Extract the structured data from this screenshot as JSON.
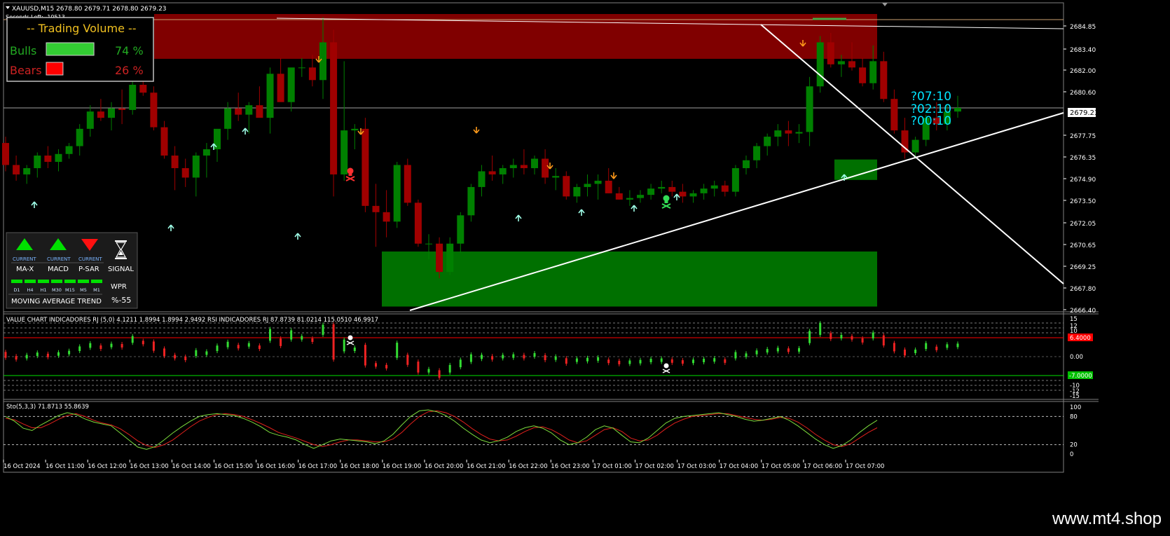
{
  "header": {
    "symbol_line": "XAUUSD,M15  2678.80 2679.71 2678.80 2679.23",
    "seconds_left": "Seconds Left:  -10513"
  },
  "volume_panel": {
    "title": "-- Trading Volume --",
    "bulls_label": "Bulls",
    "bulls_pct_text": "74 %",
    "bulls_fraction": 0.74,
    "bears_label": "Bears",
    "bears_pct_text": "26 %",
    "bears_fraction": 0.26
  },
  "timers": [
    "?07:10",
    "?02:10",
    "?00:10"
  ],
  "price_axis": {
    "ticks": [
      "2684.85",
      "2683.40",
      "2682.00",
      "2680.60",
      "2679.23",
      "2677.75",
      "2676.35",
      "2674.90",
      "2673.50",
      "2672.05",
      "2670.65",
      "2669.25",
      "2667.80",
      "2666.40"
    ],
    "current_price": "2679.23"
  },
  "signal_panel": {
    "indicators": [
      {
        "label": "MA-X",
        "status": "CURRENT",
        "direction": "up"
      },
      {
        "label": "MACD",
        "status": "CURRENT",
        "direction": "up"
      },
      {
        "label": "P-SAR",
        "status": "CURRENT",
        "direction": "down"
      }
    ],
    "signal_label": "SIGNAL",
    "timeframes": [
      "D1",
      "H4",
      "H1",
      "M30",
      "M15",
      "M5",
      "M1"
    ],
    "trend_label": "MOVING AVERAGE TREND",
    "wpr_label": "WPR",
    "wpr_value": "%-55"
  },
  "value_chart_panel": {
    "title": "VALUE CHART INDICADORES RJ (5,0) 4.1211 1.8994 1.8994 2.9492  RSI INDICADORES RJ 87.8739 81.0214 115.0510 46.9917",
    "axis_ticks": [
      "15",
      "12",
      "10",
      "0.00",
      "-10",
      "-12",
      "-15"
    ],
    "upper_level": "6.4000",
    "lower_level": "-7.0000"
  },
  "stoch_panel": {
    "title": "Sto(5,3,3) 71.8713 55.8639",
    "axis_ticks": [
      "100",
      "80",
      "20",
      "0"
    ],
    "main_line": [
      80,
      70,
      55,
      50,
      62,
      72,
      82,
      88,
      84,
      75,
      68,
      64,
      60,
      45,
      30,
      15,
      10,
      16,
      30,
      45,
      58,
      70,
      80,
      84,
      86,
      84,
      82,
      76,
      68,
      58,
      46,
      40,
      36,
      30,
      20,
      12,
      20,
      28,
      32,
      30,
      28,
      26,
      22,
      28,
      42,
      62,
      80,
      92,
      94,
      90,
      82,
      70,
      55,
      42,
      30,
      24,
      28,
      36,
      48,
      56,
      60,
      55,
      45,
      30,
      20,
      24,
      36,
      52,
      60,
      55,
      40,
      26,
      24,
      34,
      50,
      66,
      76,
      80,
      82,
      84,
      86,
      88,
      84,
      80,
      74,
      70,
      72,
      76,
      80,
      72,
      60,
      46,
      32,
      20,
      12,
      18,
      30,
      46,
      60,
      72
    ],
    "signal_line": [
      76,
      73,
      64,
      56,
      56,
      64,
      74,
      82,
      86,
      80,
      72,
      66,
      62,
      54,
      42,
      28,
      18,
      14,
      20,
      30,
      44,
      58,
      70,
      78,
      84,
      86,
      84,
      80,
      73,
      65,
      56,
      46,
      40,
      34,
      27,
      20,
      16,
      20,
      26,
      30,
      30,
      28,
      26,
      26,
      32,
      46,
      64,
      80,
      90,
      92,
      88,
      80,
      68,
      54,
      42,
      32,
      28,
      30,
      38,
      48,
      56,
      58,
      52,
      42,
      30,
      24,
      28,
      40,
      52,
      56,
      48,
      34,
      28,
      30,
      40,
      54,
      66,
      74,
      80,
      82,
      84,
      86,
      86,
      82,
      78,
      74,
      72,
      74,
      78,
      76,
      68,
      56,
      42,
      30,
      20,
      16,
      22,
      34,
      46,
      56
    ]
  },
  "time_axis": [
    "16 Oct 2024",
    "16 Oct 11:00",
    "16 Oct 12:00",
    "16 Oct 13:00",
    "16 Oct 14:00",
    "16 Oct 15:00",
    "16 Oct 16:00",
    "16 Oct 17:00",
    "16 Oct 18:00",
    "16 Oct 19:00",
    "16 Oct 20:00",
    "16 Oct 21:00",
    "16 Oct 22:00",
    "16 Oct 23:00",
    "17 Oct 01:00",
    "17 Oct 02:00",
    "17 Oct 03:00",
    "17 Oct 04:00",
    "17 Oct 05:00",
    "17 Oct 06:00",
    "17 Oct 07:00"
  ],
  "watermark": "www.mt4.shop",
  "colors": {
    "bull_candle": "#008000",
    "bear_candle": "#a00000",
    "supply_zone": "#800000",
    "demand_zone": "#007000",
    "timer": "#00e5ff",
    "stoch_main": "#7cdc3c",
    "stoch_signal": "#e0201c",
    "up_arrow": "#a0ffe8",
    "down_arrow": "#ff9a1a"
  },
  "chart_data": {
    "type": "candlestick",
    "symbol": "XAUUSD",
    "timeframe": "M15",
    "ylim": [
      2666.4,
      2685.2
    ],
    "candles": [
      [
        2677.0,
        2677.4,
        2675.2,
        2675.6
      ],
      [
        2675.6,
        2676.2,
        2674.6,
        2675.0
      ],
      [
        2675.0,
        2675.6,
        2674.4,
        2675.4
      ],
      [
        2675.4,
        2676.4,
        2674.8,
        2676.2
      ],
      [
        2676.2,
        2676.8,
        2675.4,
        2675.8
      ],
      [
        2675.8,
        2676.6,
        2675.2,
        2676.3
      ],
      [
        2676.3,
        2677.0,
        2676.0,
        2676.8
      ],
      [
        2676.8,
        2678.2,
        2676.2,
        2677.9
      ],
      [
        2677.9,
        2679.4,
        2677.4,
        2679.0
      ],
      [
        2679.0,
        2679.8,
        2678.4,
        2678.6
      ],
      [
        2678.6,
        2679.6,
        2677.8,
        2679.2
      ],
      [
        2679.2,
        2680.4,
        2678.2,
        2679.1
      ],
      [
        2679.1,
        2681.4,
        2678.8,
        2680.7
      ],
      [
        2680.7,
        2681.6,
        2680.0,
        2680.2
      ],
      [
        2680.2,
        2680.6,
        2677.8,
        2678.0
      ],
      [
        2678.0,
        2678.4,
        2676.0,
        2676.2
      ],
      [
        2676.2,
        2676.8,
        2674.0,
        2675.4
      ],
      [
        2675.4,
        2676.0,
        2674.2,
        2674.8
      ],
      [
        2674.8,
        2676.4,
        2673.6,
        2676.2
      ],
      [
        2676.2,
        2677.0,
        2674.8,
        2676.6
      ],
      [
        2676.6,
        2677.8,
        2675.8,
        2677.9
      ],
      [
        2677.9,
        2679.6,
        2677.2,
        2679.2
      ],
      [
        2679.2,
        2680.2,
        2678.4,
        2678.8
      ],
      [
        2678.8,
        2679.6,
        2677.6,
        2679.4
      ],
      [
        2679.4,
        2680.6,
        2678.8,
        2678.6
      ],
      [
        2678.6,
        2681.8,
        2677.6,
        2681.4
      ],
      [
        2681.4,
        2682.4,
        2680.4,
        2679.6
      ],
      [
        2679.6,
        2681.6,
        2679.0,
        2681.8
      ],
      [
        2681.8,
        2682.4,
        2681.2,
        2681.8
      ],
      [
        2681.8,
        2682.6,
        2680.6,
        2681.0
      ],
      [
        2681.0,
        2685.0,
        2679.8,
        2683.4
      ],
      [
        2683.4,
        2684.2,
        2673.6,
        2675.0
      ],
      [
        2675.0,
        2682.2,
        2674.6,
        2677.8
      ],
      [
        2677.8,
        2678.2,
        2676.6,
        2677.9
      ],
      [
        2677.9,
        2678.6,
        2672.6,
        2673.0
      ],
      [
        2673.0,
        2674.4,
        2670.4,
        2672.6
      ],
      [
        2672.6,
        2674.0,
        2671.0,
        2672.0
      ],
      [
        2672.0,
        2675.8,
        2671.6,
        2675.6
      ],
      [
        2675.6,
        2676.0,
        2673.0,
        2673.2
      ],
      [
        2673.2,
        2673.4,
        2670.4,
        2670.6
      ],
      [
        2670.6,
        2671.2,
        2669.6,
        2670.6
      ],
      [
        2670.6,
        2671.0,
        2668.4,
        2668.8
      ],
      [
        2668.8,
        2671.0,
        2668.6,
        2670.6
      ],
      [
        2670.6,
        2672.6,
        2670.0,
        2672.4
      ],
      [
        2672.4,
        2674.4,
        2672.0,
        2674.2
      ],
      [
        2674.2,
        2675.6,
        2673.6,
        2675.2
      ],
      [
        2675.2,
        2676.2,
        2674.6,
        2675.0
      ],
      [
        2675.0,
        2675.6,
        2674.4,
        2675.4
      ],
      [
        2675.4,
        2676.0,
        2674.8,
        2675.6
      ],
      [
        2675.6,
        2676.6,
        2675.0,
        2675.4
      ],
      [
        2675.4,
        2676.2,
        2675.0,
        2676.0
      ],
      [
        2676.0,
        2676.6,
        2674.4,
        2674.8
      ],
      [
        2674.8,
        2675.4,
        2674.0,
        2674.9
      ],
      [
        2674.9,
        2675.2,
        2673.4,
        2673.6
      ],
      [
        2673.6,
        2674.4,
        2673.2,
        2674.2
      ],
      [
        2674.2,
        2675.0,
        2673.6,
        2674.4
      ],
      [
        2674.4,
        2675.0,
        2673.4,
        2674.6
      ],
      [
        2674.6,
        2675.4,
        2673.8,
        2673.8
      ],
      [
        2673.8,
        2674.2,
        2673.4,
        2673.4
      ],
      [
        2673.4,
        2674.0,
        2673.0,
        2673.5
      ],
      [
        2673.5,
        2674.0,
        2673.2,
        2673.7
      ],
      [
        2673.7,
        2674.4,
        2673.4,
        2674.1
      ],
      [
        2674.1,
        2674.6,
        2673.8,
        2674.2
      ],
      [
        2674.2,
        2674.6,
        2673.6,
        2673.9
      ],
      [
        2673.9,
        2674.4,
        2673.2,
        2673.6
      ],
      [
        2673.6,
        2674.0,
        2673.2,
        2673.8
      ],
      [
        2673.8,
        2674.4,
        2673.4,
        2674.1
      ],
      [
        2674.1,
        2674.6,
        2673.6,
        2674.3
      ],
      [
        2674.3,
        2674.6,
        2673.6,
        2673.9
      ],
      [
        2673.9,
        2675.6,
        2673.6,
        2675.4
      ],
      [
        2675.4,
        2676.2,
        2675.0,
        2675.9
      ],
      [
        2675.9,
        2677.0,
        2675.4,
        2676.8
      ],
      [
        2676.8,
        2677.6,
        2676.2,
        2677.4
      ],
      [
        2677.4,
        2678.2,
        2676.8,
        2677.8
      ],
      [
        2677.8,
        2678.4,
        2676.8,
        2677.6
      ],
      [
        2677.6,
        2678.2,
        2677.0,
        2677.7
      ],
      [
        2677.7,
        2681.2,
        2676.8,
        2680.6
      ],
      [
        2680.6,
        2683.8,
        2680.2,
        2683.4
      ],
      [
        2683.4,
        2684.0,
        2681.8,
        2682.0
      ],
      [
        2682.0,
        2682.6,
        2681.2,
        2682.2
      ],
      [
        2682.2,
        2683.4,
        2681.6,
        2681.8
      ],
      [
        2681.8,
        2682.4,
        2680.6,
        2680.8
      ],
      [
        2680.8,
        2683.2,
        2680.4,
        2682.2
      ],
      [
        2682.2,
        2682.8,
        2679.6,
        2679.8
      ],
      [
        2679.8,
        2680.4,
        2677.6,
        2677.8
      ],
      [
        2677.8,
        2678.6,
        2676.0,
        2676.4
      ],
      [
        2676.4,
        2677.4,
        2676.0,
        2677.2
      ],
      [
        2677.2,
        2678.8,
        2676.8,
        2678.6
      ],
      [
        2678.6,
        2679.6,
        2677.8,
        2678.2
      ],
      [
        2678.2,
        2679.4,
        2677.8,
        2679.0
      ],
      [
        2679.0,
        2680.0,
        2678.6,
        2679.23
      ]
    ],
    "supply_zone": [
      2682.35,
      2685.2
    ],
    "demand_zones": [
      [
        2666.6,
        2670.1
      ],
      [
        2674.65,
        2675.95
      ]
    ]
  }
}
